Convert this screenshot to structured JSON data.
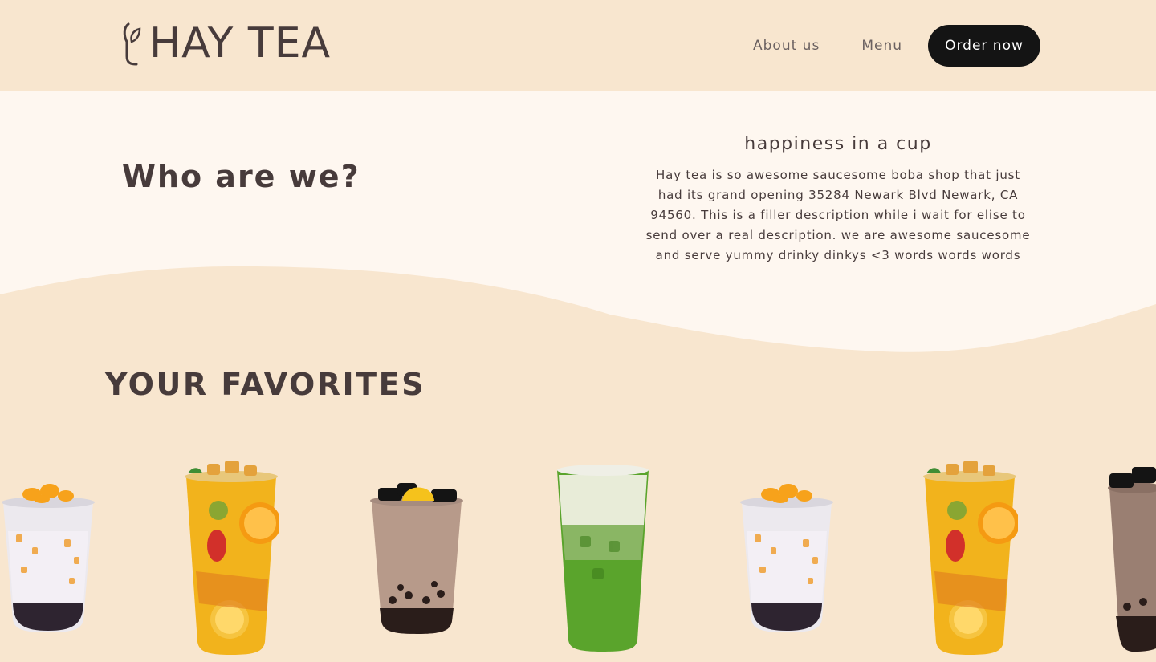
{
  "brand": {
    "name": "HAY TEA"
  },
  "nav": {
    "about_label": "About us",
    "menu_label": "Menu",
    "order_label": "Order now"
  },
  "about": {
    "title": "Who are we?",
    "subtitle": "happiness in a cup",
    "description": "Hay tea is so awesome saucesome boba shop that just had its grand opening 35284 Newark Blvd Newark, CA 94560. This is a filler description while i wait for elise to send over a real description. we are awesome saucesome and serve yummy drinky dinkys <3 words words words"
  },
  "favorites": {
    "title": "YOUR FAVORITES",
    "drinks": [
      {
        "kind": "mango-milk-tea"
      },
      {
        "kind": "fruit-tea"
      },
      {
        "kind": "grass-jelly-milk-tea"
      },
      {
        "kind": "matcha-latte"
      },
      {
        "kind": "mango-milk-tea"
      },
      {
        "kind": "fruit-tea"
      },
      {
        "kind": "grass-jelly-milk-tea"
      }
    ]
  },
  "colors": {
    "background": "#f8e6cf",
    "wave_light": "#fef7f0",
    "text": "#473b3b",
    "button": "#141414"
  }
}
